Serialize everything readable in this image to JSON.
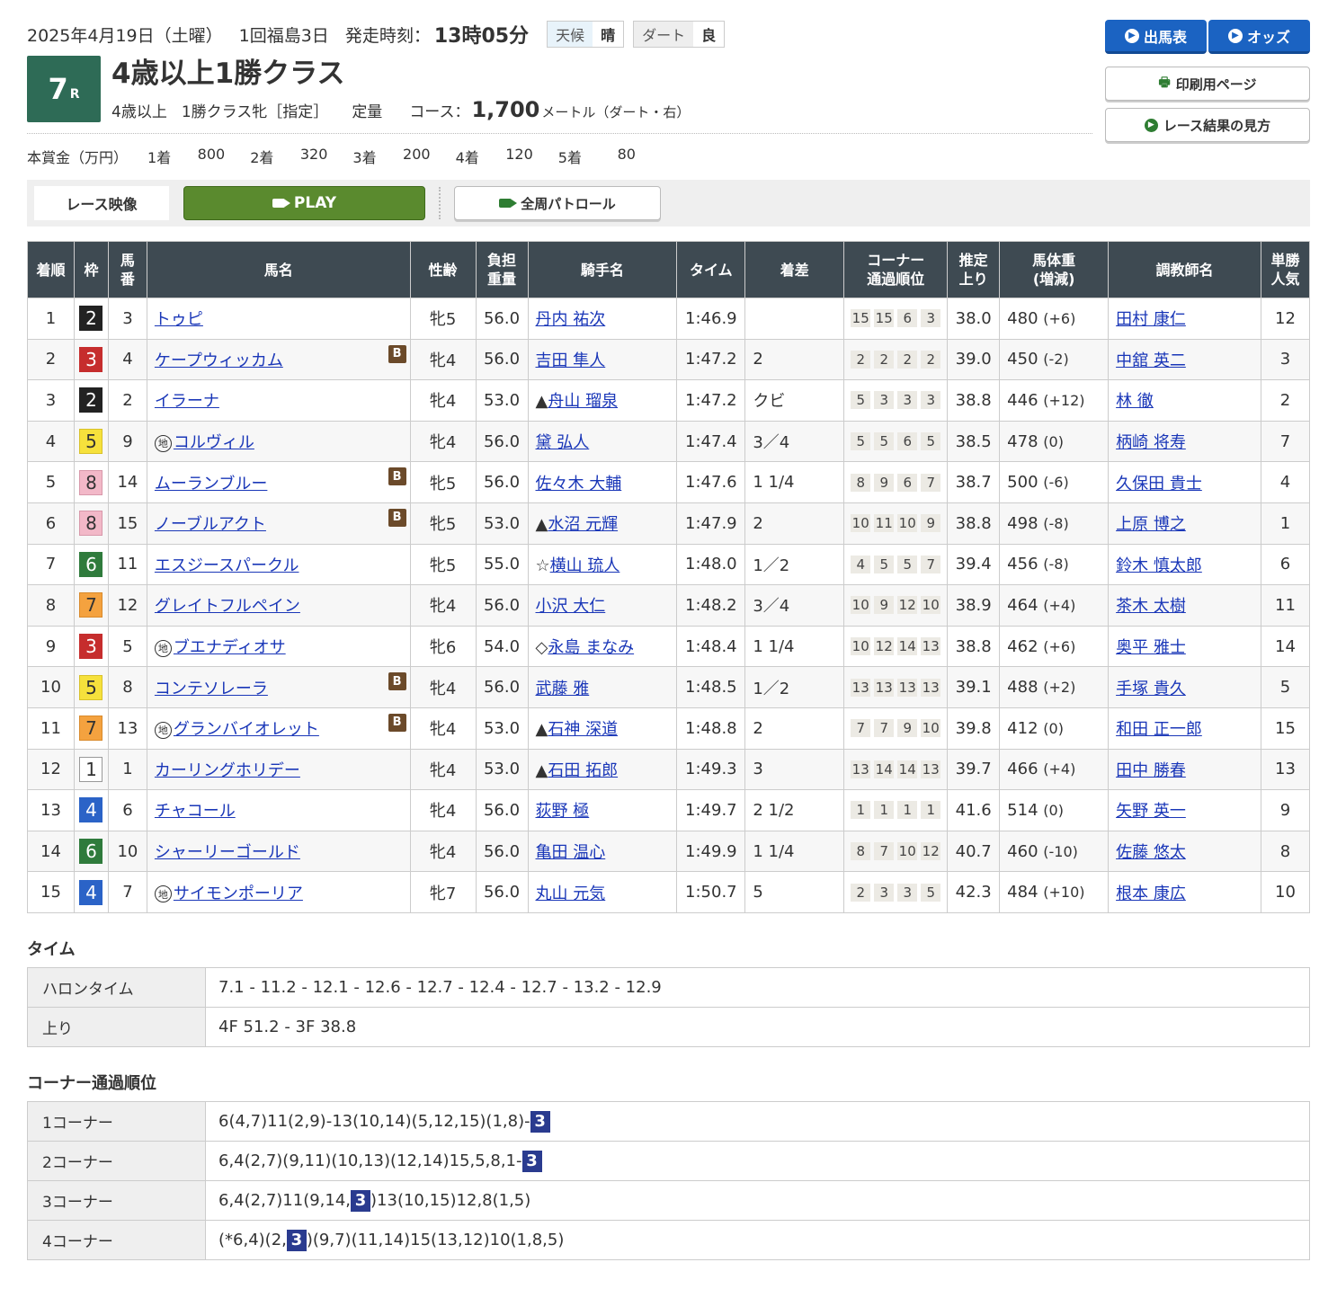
{
  "header": {
    "date": "2025年4月19日（土曜）",
    "meeting": "1回福島3日",
    "start_label": "発走時刻：",
    "start_time": "13時05分",
    "weather_label": "天候",
    "weather": "晴",
    "track_label": "ダート",
    "track_cond": "良",
    "race_no": "7",
    "race_suffix": "R",
    "race_title": "4歳以上1勝クラス",
    "cond1": "4歳以上",
    "cond2": "1勝クラス牝［指定］",
    "cond3": "定量",
    "course_label": "コース：",
    "distance": "1,700",
    "dist_unit": "メートル（ダート・右）"
  },
  "prize": {
    "label": "本賞金（万円）",
    "items": [
      {
        "k": "1着",
        "v": "800"
      },
      {
        "k": "2着",
        "v": "320"
      },
      {
        "k": "3着",
        "v": "200"
      },
      {
        "k": "4着",
        "v": "120"
      },
      {
        "k": "5着",
        "v": "80"
      }
    ]
  },
  "buttons": {
    "entries": "出馬表",
    "odds": "オッズ",
    "print": "印刷用ページ",
    "howto": "レース結果の見方"
  },
  "video": {
    "label": "レース映像",
    "play": "PLAY",
    "patrol": "全周パトロール"
  },
  "table_headers": {
    "rank": "着順",
    "waku": "枠",
    "num1": "馬",
    "num2": "番",
    "horse": "馬名",
    "sexage": "性齢",
    "w1": "負担",
    "w2": "重量",
    "jockey": "騎手名",
    "time": "タイム",
    "margin": "着差",
    "c1": "コーナー",
    "c2": "通過順位",
    "l1": "推定",
    "l2": "上り",
    "bw1": "馬体重",
    "bw2": "(増減)",
    "trainer": "調教師名",
    "p1": "単勝",
    "p2": "人気"
  },
  "rows": [
    {
      "rank": "1",
      "waku": "2",
      "num": "3",
      "horse": "トゥピ",
      "b": false,
      "chi": false,
      "sexage": "牝5",
      "weight": "56.0",
      "jmark": "",
      "jockey": "丹内 祐次",
      "time": "1:46.9",
      "margin": "",
      "corners": [
        "15",
        "15",
        "6",
        "3"
      ],
      "last": "38.0",
      "bw": "480",
      "bwd": "(+6)",
      "trainer": "田村 康仁",
      "pop": "12"
    },
    {
      "rank": "2",
      "waku": "3",
      "num": "4",
      "horse": "ケープウィッカム",
      "b": true,
      "chi": false,
      "sexage": "牝4",
      "weight": "56.0",
      "jmark": "",
      "jockey": "吉田 隼人",
      "time": "1:47.2",
      "margin": "2",
      "corners": [
        "2",
        "2",
        "2",
        "2"
      ],
      "last": "39.0",
      "bw": "450",
      "bwd": "(-2)",
      "trainer": "中舘 英二",
      "pop": "3"
    },
    {
      "rank": "3",
      "waku": "2",
      "num": "2",
      "horse": "イラーナ",
      "b": false,
      "chi": false,
      "sexage": "牝4",
      "weight": "53.0",
      "jmark": "▲",
      "jockey": "舟山 瑠泉",
      "time": "1:47.2",
      "margin": "クビ",
      "corners": [
        "5",
        "3",
        "3",
        "3"
      ],
      "last": "38.8",
      "bw": "446",
      "bwd": "(+12)",
      "trainer": "林 徹",
      "pop": "2"
    },
    {
      "rank": "4",
      "waku": "5",
      "num": "9",
      "horse": "コルヴィル",
      "b": false,
      "chi": true,
      "sexage": "牝4",
      "weight": "56.0",
      "jmark": "",
      "jockey": "黛 弘人",
      "time": "1:47.4",
      "margin": "3／4",
      "corners": [
        "5",
        "5",
        "6",
        "5"
      ],
      "last": "38.5",
      "bw": "478",
      "bwd": "(0)",
      "trainer": "柄崎 将寿",
      "pop": "7"
    },
    {
      "rank": "5",
      "waku": "8",
      "num": "14",
      "horse": "ムーランブルー",
      "b": true,
      "chi": false,
      "sexage": "牝5",
      "weight": "56.0",
      "jmark": "",
      "jockey": "佐々木 大輔",
      "time": "1:47.6",
      "margin": "1 1/4",
      "corners": [
        "8",
        "9",
        "6",
        "7"
      ],
      "last": "38.7",
      "bw": "500",
      "bwd": "(-6)",
      "trainer": "久保田 貴士",
      "pop": "4"
    },
    {
      "rank": "6",
      "waku": "8",
      "num": "15",
      "horse": "ノーブルアクト",
      "b": true,
      "chi": false,
      "sexage": "牝5",
      "weight": "53.0",
      "jmark": "▲",
      "jockey": "水沼 元輝",
      "time": "1:47.9",
      "margin": "2",
      "corners": [
        "10",
        "11",
        "10",
        "9"
      ],
      "last": "38.8",
      "bw": "498",
      "bwd": "(-8)",
      "trainer": "上原 博之",
      "pop": "1"
    },
    {
      "rank": "7",
      "waku": "6",
      "num": "11",
      "horse": "エスジースパークル",
      "b": false,
      "chi": false,
      "sexage": "牝5",
      "weight": "55.0",
      "jmark": "☆",
      "jockey": "横山 琉人",
      "time": "1:48.0",
      "margin": "1／2",
      "corners": [
        "4",
        "5",
        "5",
        "7"
      ],
      "last": "39.4",
      "bw": "456",
      "bwd": "(-8)",
      "trainer": "鈴木 慎太郎",
      "pop": "6"
    },
    {
      "rank": "8",
      "waku": "7",
      "num": "12",
      "horse": "グレイトフルペイン",
      "b": false,
      "chi": false,
      "sexage": "牝4",
      "weight": "56.0",
      "jmark": "",
      "jockey": "小沢 大仁",
      "time": "1:48.2",
      "margin": "3／4",
      "corners": [
        "10",
        "9",
        "12",
        "10"
      ],
      "last": "38.9",
      "bw": "464",
      "bwd": "(+4)",
      "trainer": "茶木 太樹",
      "pop": "11"
    },
    {
      "rank": "9",
      "waku": "3",
      "num": "5",
      "horse": "ブエナディオサ",
      "b": false,
      "chi": true,
      "sexage": "牝6",
      "weight": "54.0",
      "jmark": "◇",
      "jockey": "永島 まなみ",
      "time": "1:48.4",
      "margin": "1 1/4",
      "corners": [
        "10",
        "12",
        "14",
        "13"
      ],
      "last": "38.8",
      "bw": "462",
      "bwd": "(+6)",
      "trainer": "奥平 雅士",
      "pop": "14"
    },
    {
      "rank": "10",
      "waku": "5",
      "num": "8",
      "horse": "コンテソレーラ",
      "b": true,
      "chi": false,
      "sexage": "牝4",
      "weight": "56.0",
      "jmark": "",
      "jockey": "武藤 雅",
      "time": "1:48.5",
      "margin": "1／2",
      "corners": [
        "13",
        "13",
        "13",
        "13"
      ],
      "last": "39.1",
      "bw": "488",
      "bwd": "(+2)",
      "trainer": "手塚 貴久",
      "pop": "5"
    },
    {
      "rank": "11",
      "waku": "7",
      "num": "13",
      "horse": "グランバイオレット",
      "b": true,
      "chi": true,
      "sexage": "牝4",
      "weight": "53.0",
      "jmark": "▲",
      "jockey": "石神 深道",
      "time": "1:48.8",
      "margin": "2",
      "corners": [
        "7",
        "7",
        "9",
        "10"
      ],
      "last": "39.8",
      "bw": "412",
      "bwd": "(0)",
      "trainer": "和田 正一郎",
      "pop": "15"
    },
    {
      "rank": "12",
      "waku": "1",
      "num": "1",
      "horse": "カーリングホリデー",
      "b": false,
      "chi": false,
      "sexage": "牝4",
      "weight": "53.0",
      "jmark": "▲",
      "jockey": "石田 拓郎",
      "time": "1:49.3",
      "margin": "3",
      "corners": [
        "13",
        "14",
        "14",
        "13"
      ],
      "last": "39.7",
      "bw": "466",
      "bwd": "(+4)",
      "trainer": "田中 勝春",
      "pop": "13"
    },
    {
      "rank": "13",
      "waku": "4",
      "num": "6",
      "horse": "チャコール",
      "b": false,
      "chi": false,
      "sexage": "牝4",
      "weight": "56.0",
      "jmark": "",
      "jockey": "荻野 極",
      "time": "1:49.7",
      "margin": "2 1/2",
      "corners": [
        "1",
        "1",
        "1",
        "1"
      ],
      "last": "41.6",
      "bw": "514",
      "bwd": "(0)",
      "trainer": "矢野 英一",
      "pop": "9"
    },
    {
      "rank": "14",
      "waku": "6",
      "num": "10",
      "horse": "シャーリーゴールド",
      "b": false,
      "chi": false,
      "sexage": "牝4",
      "weight": "56.0",
      "jmark": "",
      "jockey": "亀田 温心",
      "time": "1:49.9",
      "margin": "1 1/4",
      "corners": [
        "8",
        "7",
        "10",
        "12"
      ],
      "last": "40.7",
      "bw": "460",
      "bwd": "(-10)",
      "trainer": "佐藤 悠太",
      "pop": "8"
    },
    {
      "rank": "15",
      "waku": "4",
      "num": "7",
      "horse": "サイモンポーリア",
      "b": false,
      "chi": true,
      "sexage": "牝7",
      "weight": "56.0",
      "jmark": "",
      "jockey": "丸山 元気",
      "time": "1:50.7",
      "margin": "5",
      "corners": [
        "2",
        "3",
        "3",
        "5"
      ],
      "last": "42.3",
      "bw": "484",
      "bwd": "(+10)",
      "trainer": "根本 康広",
      "pop": "10"
    }
  ],
  "marks": {
    "b": "B",
    "chi": "地"
  },
  "time_section": {
    "title": "タイム",
    "rows": [
      {
        "k": "ハロンタイム",
        "v": "7.1 - 11.2 - 12.1 - 12.6 - 12.7 - 12.4 - 12.7 - 13.2 - 12.9"
      },
      {
        "k": "上り",
        "v": "4F 51.2 - 3F 38.8"
      }
    ]
  },
  "corner_section": {
    "title": "コーナー通過順位",
    "highlight": "3",
    "rows": [
      {
        "k": "1コーナー",
        "pre": "6(4,7)11(2,9)-13(10,14)(5,12,15)(1,8)-",
        "post": ""
      },
      {
        "k": "2コーナー",
        "pre": "6,4(2,7)(9,11)(10,13)(12,14)15,5,8,1-",
        "post": ""
      },
      {
        "k": "3コーナー",
        "pre": "6,4(2,7)11(9,14,",
        "post": ")13(10,15)12,8(1,5)"
      },
      {
        "k": "4コーナー",
        "pre": "(*6,4)(2,",
        "post": ")(9,7)(11,14)15(13,12)10(1,8,5)"
      }
    ]
  }
}
